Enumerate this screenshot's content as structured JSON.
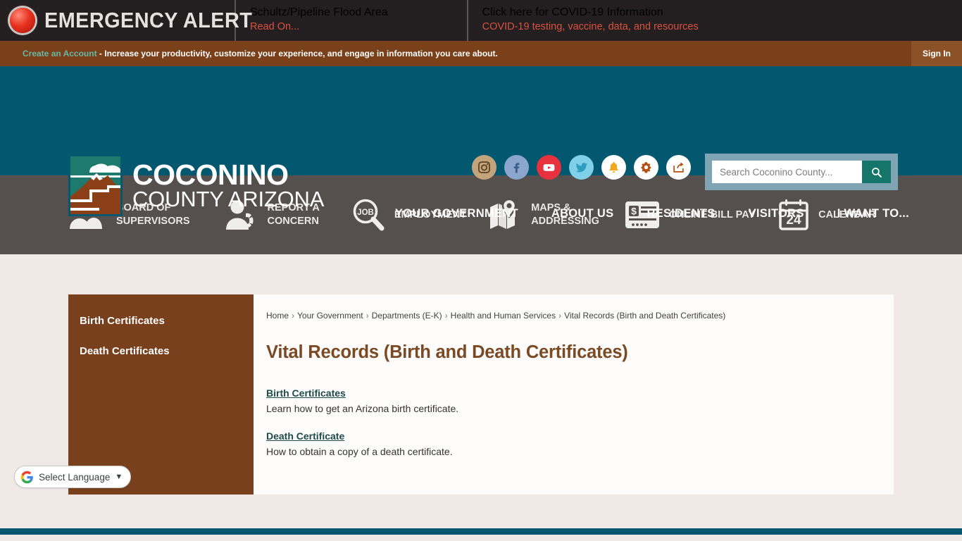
{
  "emergency": {
    "badge_label": "EMERGENCY ALERT",
    "alerts": [
      {
        "title": "Schultz/Pipeline Flood Area",
        "subtitle": "Read On..."
      },
      {
        "title": "Click here for COVID-19 Information",
        "subtitle": "COVID-19 testing, vaccine, data, and resources"
      }
    ]
  },
  "account_bar": {
    "create_link": "Create an Account",
    "tagline": " - Increase your productivity, customize your experience, and engage in information you care about.",
    "sign_in": "Sign In"
  },
  "header": {
    "logo_line1": "COCONINO",
    "logo_line2": "COUNTY ARIZONA",
    "social": [
      {
        "name": "instagram-icon",
        "label": "Instagram",
        "bg": "#c4a57b"
      },
      {
        "name": "facebook-icon",
        "label": "Facebook",
        "bg": "#8ba6cc"
      },
      {
        "name": "youtube-icon",
        "label": "YouTube",
        "bg": "#e8313e"
      },
      {
        "name": "twitter-icon",
        "label": "Twitter",
        "bg": "#7fd0e8"
      },
      {
        "name": "notify-me-bell-icon",
        "label": "Notify Me",
        "bg": "#ffffff"
      },
      {
        "name": "gear-icon",
        "label": "Site Tools",
        "bg": "#ffffff"
      },
      {
        "name": "share-icon",
        "label": "Share",
        "bg": "#ffffff"
      }
    ],
    "search": {
      "placeholder": "Search Coconino County...",
      "value": "",
      "button_icon": "search-icon",
      "accent": "#15756a"
    },
    "nav": [
      "YOUR GOVERNMENT",
      "ABOUT US",
      "RESIDENTS",
      "VISITORS",
      "I WANT TO..."
    ],
    "bg_color": "#03576f"
  },
  "quicklinks": {
    "bg_color": "#55504d",
    "items": [
      {
        "icon": "people-icon",
        "label": "BOARD OF\nSUPERVISORS"
      },
      {
        "icon": "report-concern-icon",
        "label": "REPORT A\nCONCERN"
      },
      {
        "icon": "job-search-icon",
        "label": "EMPLOYMENT"
      },
      {
        "icon": "map-pin-icon",
        "label": "MAPS &\nADDRESSING"
      },
      {
        "icon": "bill-pay-icon",
        "label": "ONLINE BILL PAY"
      },
      {
        "icon": "calendar-icon",
        "label": "CALENDAR"
      }
    ]
  },
  "sidebar": {
    "bg_color": "#78401c",
    "items": [
      {
        "label": "Birth Certificates"
      },
      {
        "label": "Death Certificates"
      }
    ]
  },
  "breadcrumb": {
    "separator": "›",
    "items": [
      "Home",
      "Your Government",
      "Departments (E-K)",
      "Health and Human Services",
      "Vital Records (Birth and Death Certificates)"
    ]
  },
  "main": {
    "title": "Vital Records (Birth and Death Certificates)",
    "title_color": "#7a4a24",
    "entries": [
      {
        "link": "Birth Certificates",
        "description": "Learn how to get an Arizona birth certificate."
      },
      {
        "link": "Death Certificate",
        "description": "How to obtain a copy of a death certificate."
      }
    ]
  },
  "translate": {
    "icon": "google-g-icon",
    "label": "Select Language",
    "caret": "▼"
  }
}
